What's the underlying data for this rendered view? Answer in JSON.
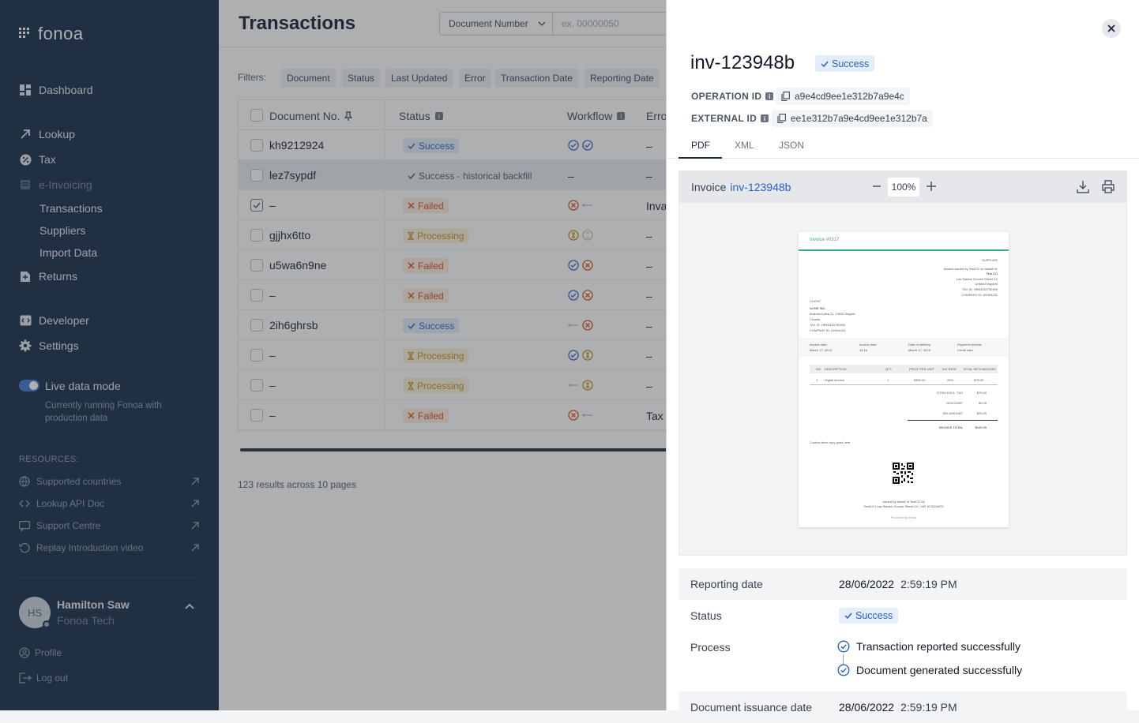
{
  "sidebar": {
    "logo": "fonoa",
    "nav": {
      "dashboard": "Dashboard",
      "lookup": "Lookup",
      "tax": "Tax",
      "einvoicing": "e-Invoicing",
      "transactions": "Transactions",
      "suppliers": "Suppliers",
      "import_data": "Import Data",
      "returns": "Returns",
      "developer": "Developer",
      "settings": "Settings"
    },
    "live_mode": {
      "label": "Live data mode",
      "description": "Currently running Fonoa with production data"
    },
    "resources": {
      "title": "RESOURCES:",
      "items": [
        "Supported countries",
        "Lookup API Doc",
        "Support Centre",
        "Replay Introduction video"
      ]
    },
    "user": {
      "initials": "HS",
      "name": "Hamilton Saw",
      "org": "Fonoa Tech"
    },
    "footer": {
      "profile": "Profile",
      "logout": "Log out"
    }
  },
  "main": {
    "title": "Transactions",
    "search": {
      "select_value": "Document Number",
      "placeholder": "ex. 00000050"
    },
    "filters_label": "Filters:",
    "filters": [
      "Document",
      "Status",
      "Last Updated",
      "Error",
      "Transaction Date",
      "Reporting Date"
    ],
    "columns": [
      "Document No.",
      "Status",
      "Workflow",
      "Erro"
    ],
    "rows": [
      {
        "doc": "kh9212924",
        "status": "Success",
        "type": "success",
        "err": "–"
      },
      {
        "doc": "lez7sypdf",
        "status": "Success - historical backfill",
        "type": "hist",
        "err": "–"
      },
      {
        "doc": "–",
        "status": "Failed",
        "type": "failed",
        "err": "Inva"
      },
      {
        "doc": "gjjhx6tto",
        "status": "Processing",
        "type": "proc",
        "err": "–"
      },
      {
        "doc": "u5wa6n9ne",
        "status": "Failed",
        "type": "failed",
        "err": "–"
      },
      {
        "doc": "–",
        "status": "Failed",
        "type": "failed",
        "err": "–"
      },
      {
        "doc": "2ih6ghrsb",
        "status": "Success",
        "type": "success",
        "err": "–"
      },
      {
        "doc": "–",
        "status": "Processing",
        "type": "proc",
        "err": "–"
      },
      {
        "doc": "–",
        "status": "Processing",
        "type": "proc",
        "err": "–"
      },
      {
        "doc": "–",
        "status": "Failed",
        "type": "failed",
        "err": "Tax"
      }
    ],
    "results_text": "123 results across 10 pages"
  },
  "panel": {
    "title": "inv-123948b",
    "status": "Success",
    "operation_id_label": "OPERATION ID",
    "operation_id": "a9e4cd9ee1e312b7a9e4c",
    "external_id_label": "EXTERNAL ID",
    "external_id": "ee1e312b7a9e4cd9ee1e312b7a",
    "tabs": [
      "PDF",
      "XML",
      "JSON"
    ],
    "viewer": {
      "label": "Invoice",
      "doc_link": "inv-123948b",
      "zoom": "100%"
    },
    "invoice_preview": {
      "header": "Invoice",
      "number": "#0317",
      "supplier_title": "SUPPLIER",
      "supplier_lines": [
        "Invoice issued by TestCO on behalf of:",
        "Test CO",
        "Las Santos Groove Street C2",
        "United Kingdom",
        "TAX ID: HR63433750469",
        "COMPANY ID: AX454131"
      ],
      "client_title": "CLIENT",
      "client_lines": [
        "ACME INC.",
        "Bulevard ulica 11, 10000 Zagreb",
        "Croatia",
        "TAX ID: HR63433750469",
        "COMPANY ID: AX454131"
      ],
      "meta_labels": [
        "Invoice date:",
        "Invoice time:",
        "Date of delivery:",
        "Payment method:"
      ],
      "meta_values": [
        "March 17, 2019",
        "14:16",
        "March 17, 2019",
        "Credit card"
      ],
      "table_headers": [
        "NO.",
        "DESCRIPTION",
        "QTY",
        "PRICE PER UNIT",
        "TAX RATE",
        "TOTAL WITH AMOUNT"
      ],
      "table_row": [
        "1",
        "Digital service",
        "1",
        "$300.00",
        "25%",
        "$75.00"
      ],
      "totals": [
        [
          "TOTAL EXCL. TAX",
          "$75.00"
        ],
        [
          "DISCOUNT",
          "$0.00"
        ],
        [
          "TAX AMOUNT",
          "$25.00"
        ],
        [
          "INVOICE TOTAL",
          "$100.00"
        ]
      ],
      "note": "Custom term copy goes here",
      "footer_lines": [
        "Issued by behalf of TestCO by",
        "TestCO / Las Santos Groove Street C2 / VAT 6C3204976"
      ],
      "powered": "Powered by fonoa"
    },
    "details": {
      "reporting_date_label": "Reporting date",
      "reporting_date": "28/06/2022",
      "reporting_time": "2:59:19 PM",
      "status_label": "Status",
      "status": "Success",
      "process_label": "Process",
      "process_steps": [
        "Transaction reported successfully",
        "Document generated successfully"
      ],
      "issuance_label": "Document issuance date",
      "issuance_date": "28/06/2022",
      "issuance_time": "2:59:19 PM"
    }
  },
  "colors": {
    "sidebar_bg": "#0d2340",
    "accent": "#2860c4",
    "success_bg": "#e4edfa",
    "failed": "#d9480f",
    "processing": "#c58a12",
    "invoice_green": "#34b27b"
  }
}
